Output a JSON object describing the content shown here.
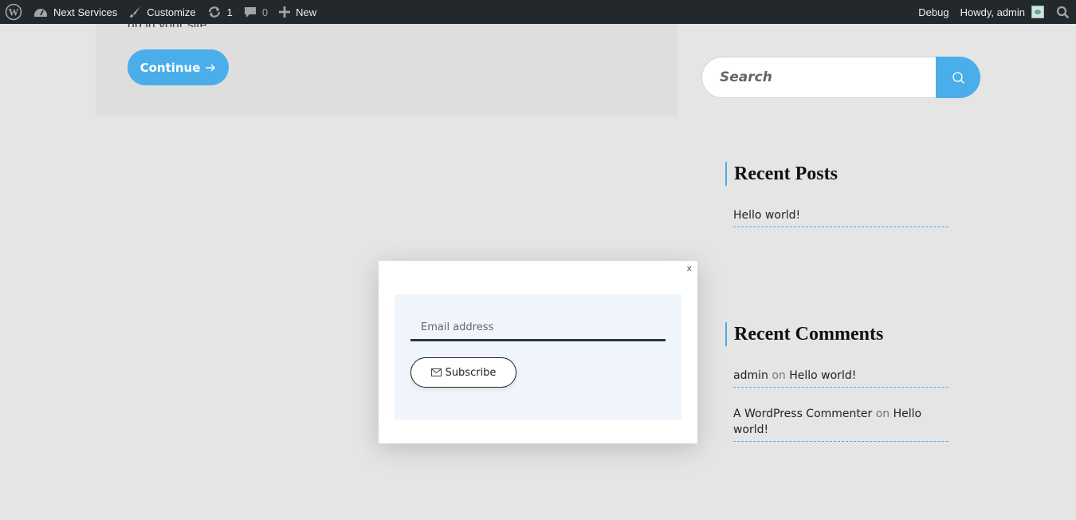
{
  "adminbar": {
    "site_name": "Next Services",
    "customize": "Customize",
    "updates_count": "1",
    "comments_count": "0",
    "new_label": "New",
    "debug_label": "Debug",
    "howdy": "Howdy, admin"
  },
  "post": {
    "excerpt": "up in your site...",
    "continue_label": "Continue"
  },
  "sidebar": {
    "search_placeholder": "Search",
    "recent_posts_title": "Recent Posts",
    "recent_posts": [
      "Hello world!"
    ],
    "recent_comments_title": "Recent Comments",
    "recent_comments": [
      {
        "author": "admin",
        "on": "on",
        "post": "Hello world!"
      },
      {
        "author": "A WordPress Commenter",
        "on": "on",
        "post": "Hello world!"
      }
    ]
  },
  "popup": {
    "close_label": "x",
    "email_placeholder": "Email address",
    "subscribe_label": "Subscribe"
  },
  "colors": {
    "accent": "#4aaeea",
    "adminbar_bg": "#23282d",
    "page_bg": "#e5e5e5"
  }
}
